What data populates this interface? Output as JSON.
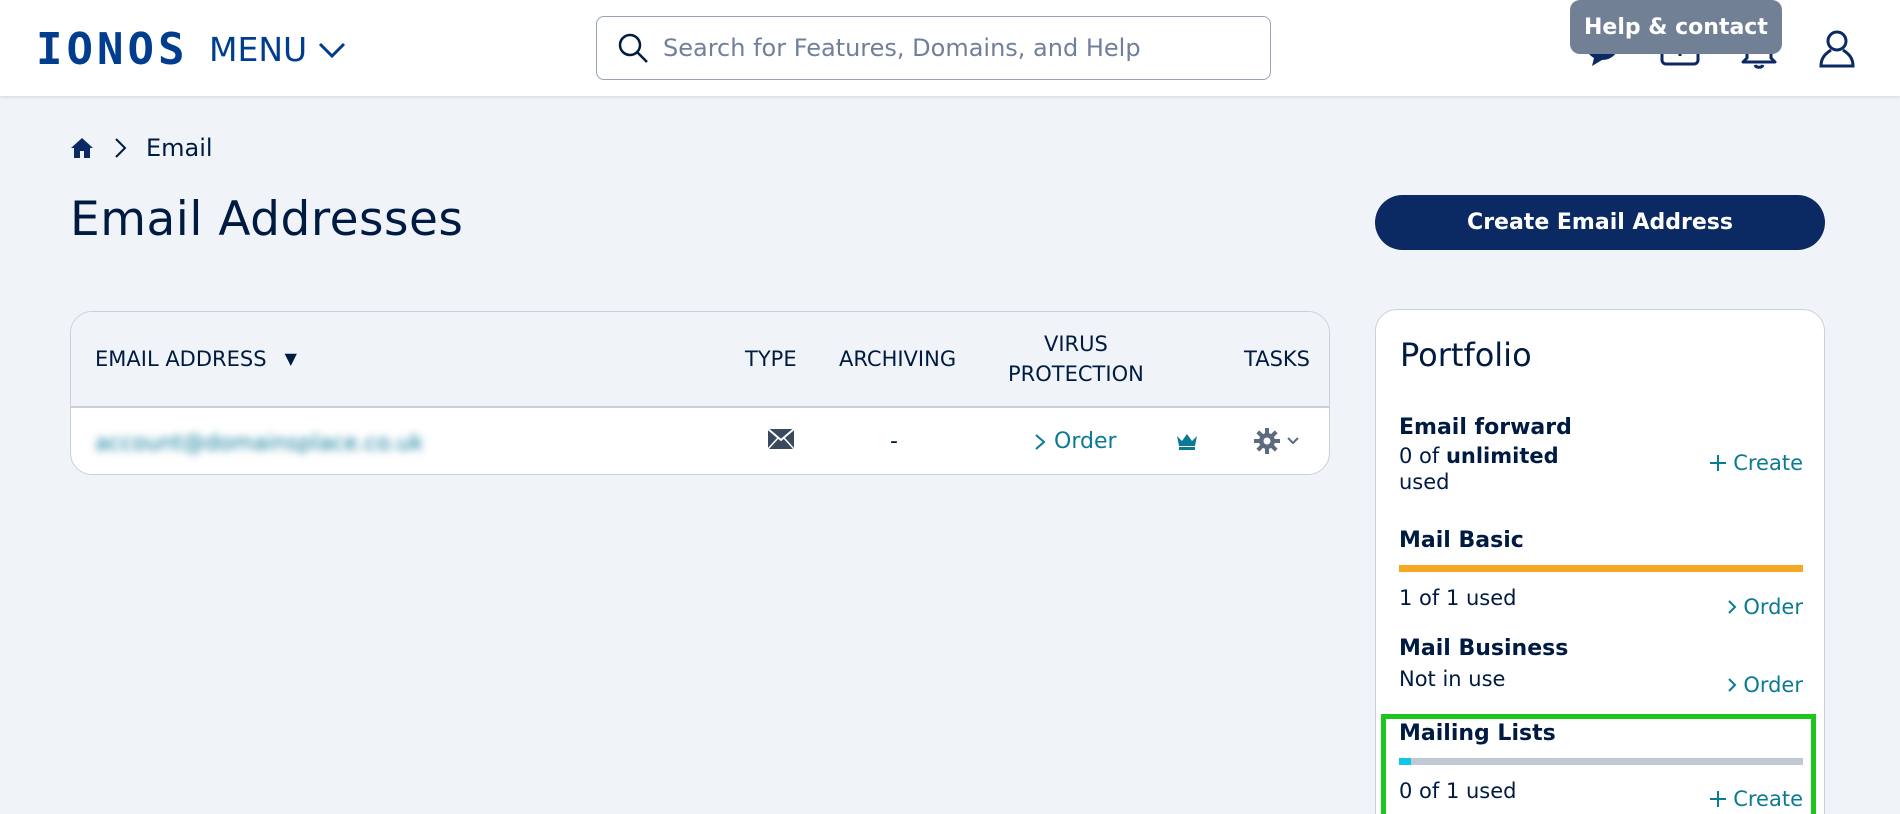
{
  "header": {
    "logo": "IONOS",
    "menu_label": "MENU",
    "search_placeholder": "Search for Features, Domains, and Help",
    "tooltip": "Help & contact",
    "icons": [
      "chat-icon",
      "plus-box-icon",
      "bell-icon",
      "user-icon"
    ]
  },
  "breadcrumb": {
    "current": "Email"
  },
  "page": {
    "title": "Email Addresses",
    "create_button": "Create Email Address"
  },
  "table": {
    "columns": [
      "EMAIL ADDRESS",
      "TYPE",
      "ARCHIVING",
      "VIRUS PROTECTION",
      "TASKS"
    ],
    "col_virus_line1": "VIRUS",
    "col_virus_line2": "PROTECTION",
    "rows": [
      {
        "email": "account@domainsplace.co.uk",
        "type_icon": "envelope-icon",
        "archiving": "-",
        "virus_protection": "Order",
        "tasks_icon": "gear-icon"
      }
    ]
  },
  "portfolio": {
    "title": "Portfolio",
    "items": [
      {
        "name": "Email forward",
        "usage_prefix": "0 of ",
        "usage_bold": "unlimited",
        "usage_suffix": "used",
        "action": "Create"
      },
      {
        "name": "Mail Basic",
        "usage": "1 of 1 used",
        "action": "Order",
        "used": 1,
        "total": 1,
        "bar_color": "#f7a823"
      },
      {
        "name": "Mail Business",
        "usage": "Not in use",
        "action": "Order"
      },
      {
        "name": "Mailing Lists",
        "usage": "0 of 1 used",
        "action": "Create",
        "used": 0,
        "total": 1,
        "bar_color": "#11c7e6"
      }
    ]
  }
}
